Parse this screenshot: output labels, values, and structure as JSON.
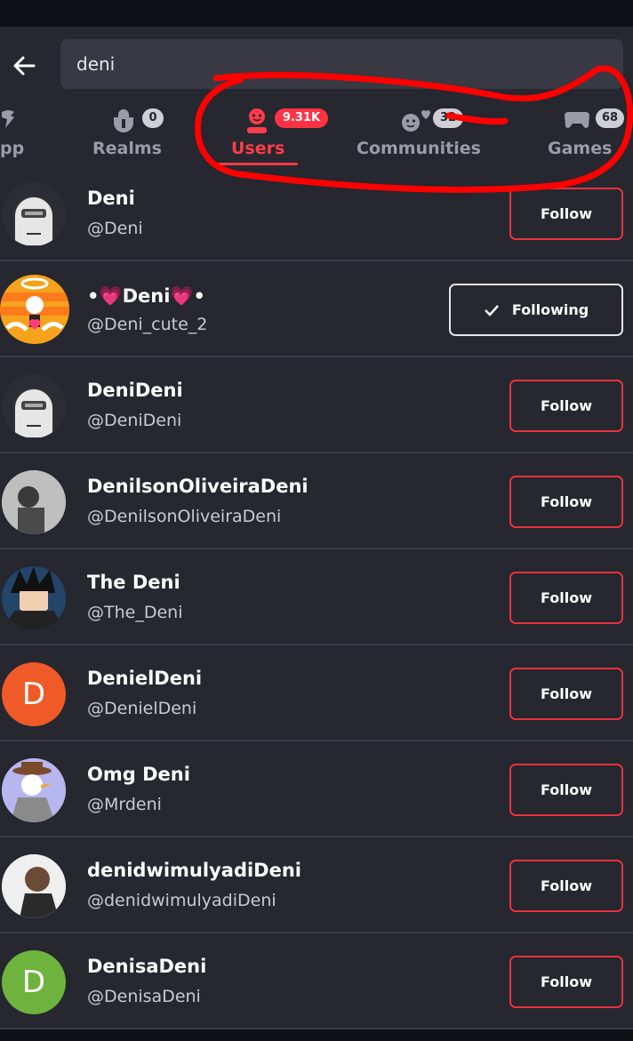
{
  "search": {
    "value": "deni"
  },
  "tabs": [
    {
      "label": "pp",
      "icon": "app-icon",
      "badge": ""
    },
    {
      "label": "Realms",
      "icon": "realms-icon",
      "badge": "0"
    },
    {
      "label": "Users",
      "icon": "user-icon",
      "badge": "9.31K",
      "active": true
    },
    {
      "label": "Communities",
      "icon": "communities-icon",
      "badge": "32"
    },
    {
      "label": "Games",
      "icon": "gamepad-icon",
      "badge": "68"
    }
  ],
  "users": [
    {
      "name": "Deni",
      "handle": "@Deni",
      "action": "Follow",
      "avatar": "default-avatar"
    },
    {
      "name": "•💗Deni💗•",
      "handle": "@Deni_cute_2",
      "action": "Following",
      "avatar": "angel-avatar"
    },
    {
      "name": "DeniDeni",
      "handle": "@DeniDeni",
      "action": "Follow",
      "avatar": "default-avatar"
    },
    {
      "name": "DenilsonOliveiraDeni",
      "handle": "@DenilsonOliveiraDeni",
      "action": "Follow",
      "avatar": "photo-avatar"
    },
    {
      "name": "The Deni",
      "handle": "@The_Deni",
      "action": "Follow",
      "avatar": "anime-avatar"
    },
    {
      "name": "DenielDeni",
      "handle": "@DenielDeni",
      "action": "Follow",
      "avatar": "letter-avatar",
      "letter": "D",
      "color": "#f05a28"
    },
    {
      "name": "Omg Deni",
      "handle": "@Mrdeni",
      "action": "Follow",
      "avatar": "duck-avatar"
    },
    {
      "name": "denidwimulyadiDeni",
      "handle": "@denidwimulyadiDeni",
      "action": "Follow",
      "avatar": "photo-avatar"
    },
    {
      "name": "DenisaDeni",
      "handle": "@DenisaDeni",
      "action": "Follow",
      "avatar": "letter-avatar",
      "letter": "D",
      "color": "#6fb33f"
    }
  ],
  "colors": {
    "accent": "#ff3d4a",
    "background": "#26272f",
    "annotation": "#ff0000"
  }
}
